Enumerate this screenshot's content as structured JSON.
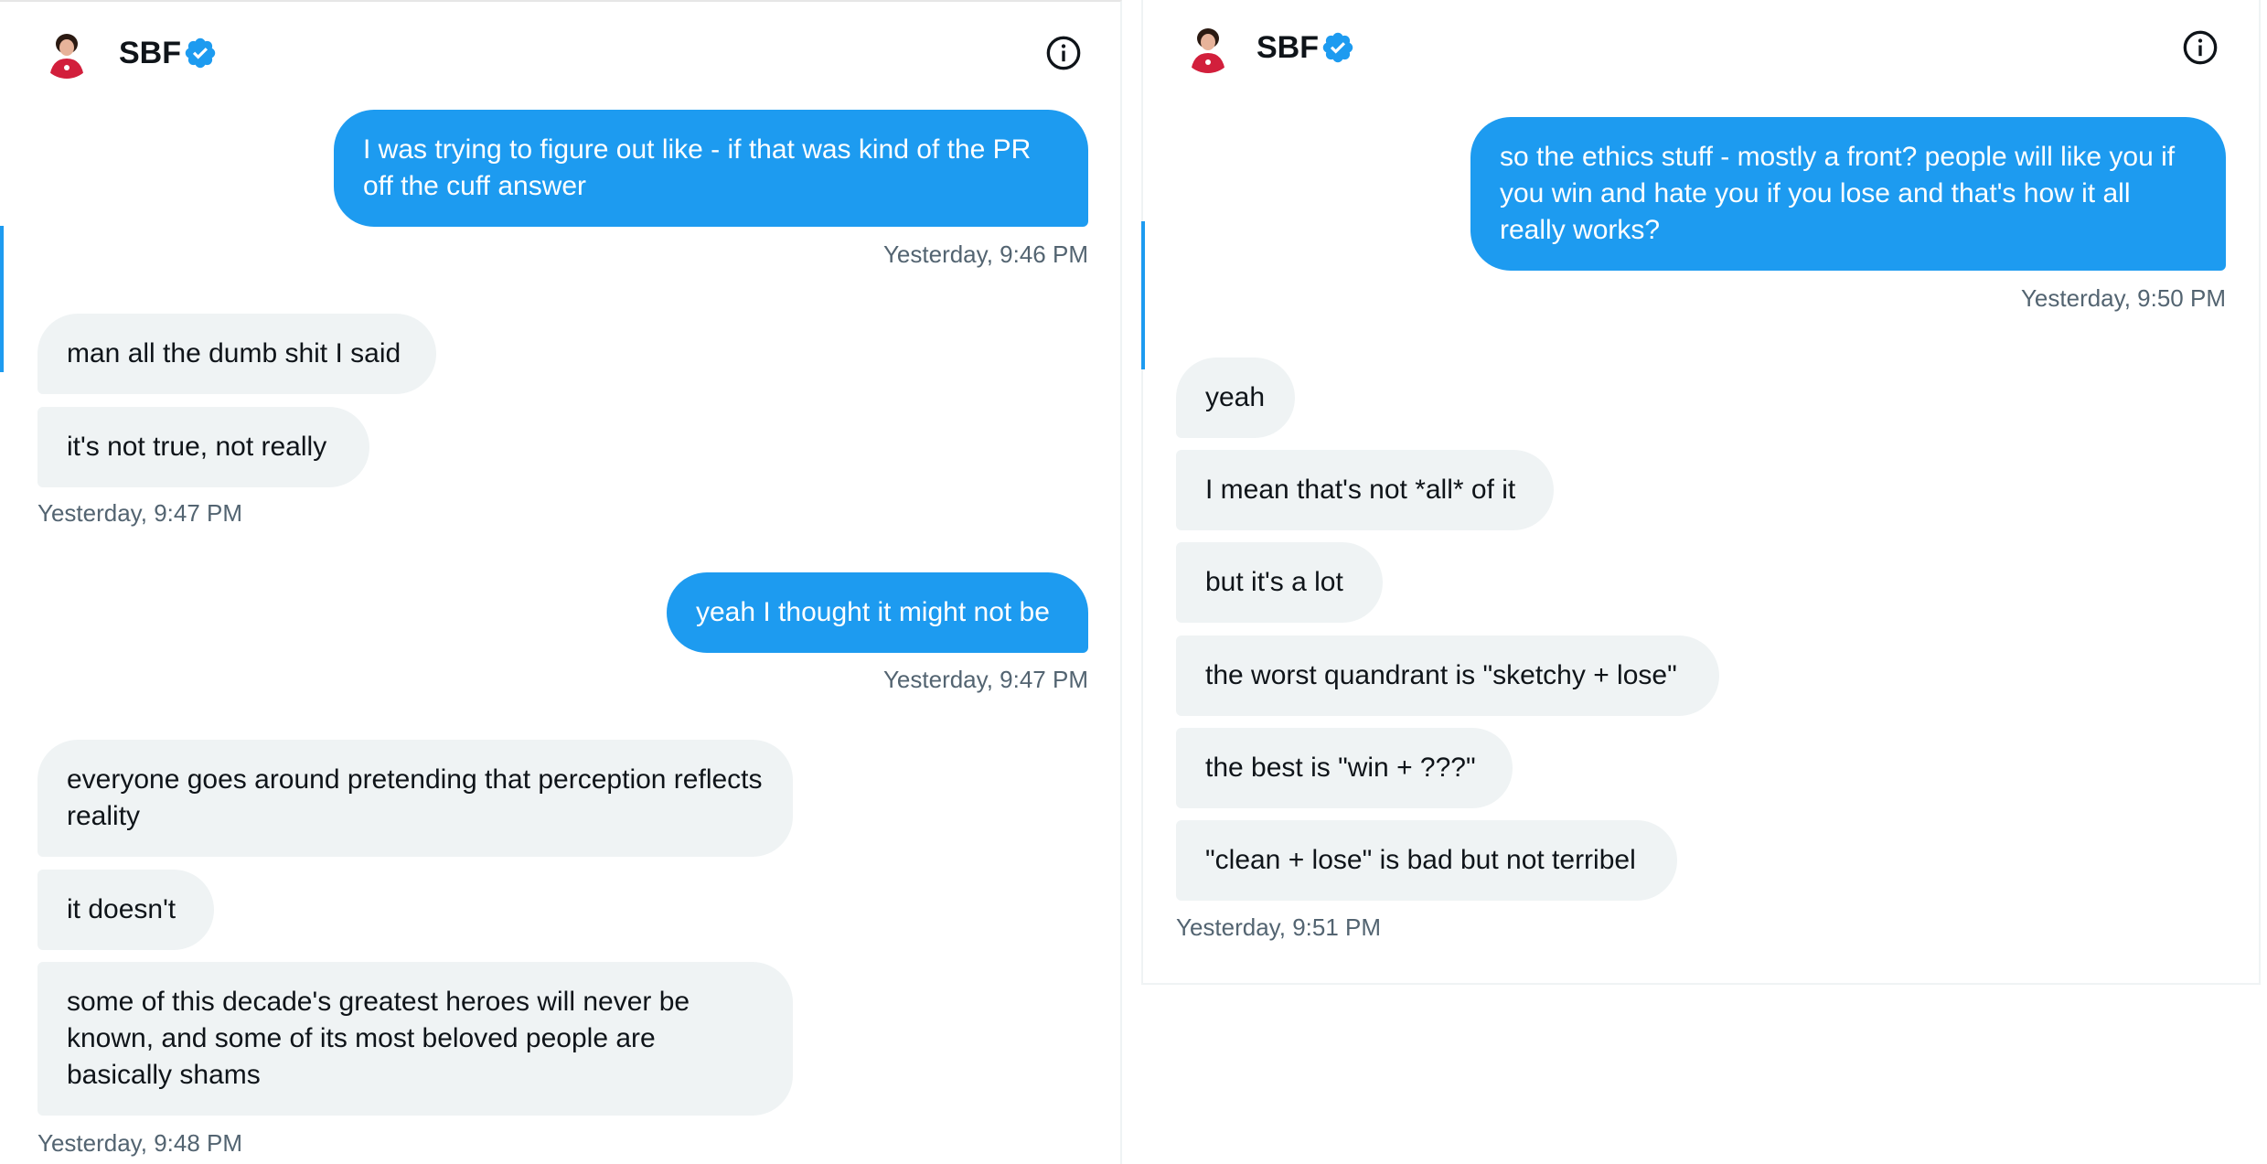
{
  "left": {
    "contact_name": "SBF",
    "messages": [
      {
        "text": "I was trying to figure out like - if that was kind of the PR off the cuff answer"
      },
      {
        "text": "man all the dumb shit I said"
      },
      {
        "text": "it's not true, not really"
      },
      {
        "text": "yeah I thought it might not be"
      },
      {
        "text": "everyone goes around pretending that perception reflects reality"
      },
      {
        "text": "it doesn't"
      },
      {
        "text": "some of this decade's greatest heroes will never be known, and some of its most beloved people are basically shams"
      }
    ],
    "timestamps": [
      "Yesterday, 9:46 PM",
      "Yesterday, 9:47 PM",
      "Yesterday, 9:47 PM",
      "Yesterday, 9:48 PM"
    ]
  },
  "right": {
    "contact_name": "SBF",
    "messages": [
      {
        "text": "so the ethics stuff - mostly a front? people will like you if you win and hate you if you lose and that's how it all really works?"
      },
      {
        "text": "yeah"
      },
      {
        "text": "I mean that's not *all* of it"
      },
      {
        "text": "but it's a lot"
      },
      {
        "text": "the worst quandrant is \"sketchy + lose\""
      },
      {
        "text": "the best is \"win + ???\""
      },
      {
        "text": "\"clean + lose\" is bad but not terribel"
      }
    ],
    "timestamps": [
      "Yesterday, 9:50 PM",
      "Yesterday, 9:51 PM"
    ]
  },
  "colors": {
    "outgoing_bubble": "#1d9bf0",
    "incoming_bubble": "#eff3f4",
    "verified_badge": "#1d9bf0",
    "timestamp_text": "#536471"
  },
  "icons": [
    "avatar",
    "verified-badge-icon",
    "info-icon"
  ]
}
